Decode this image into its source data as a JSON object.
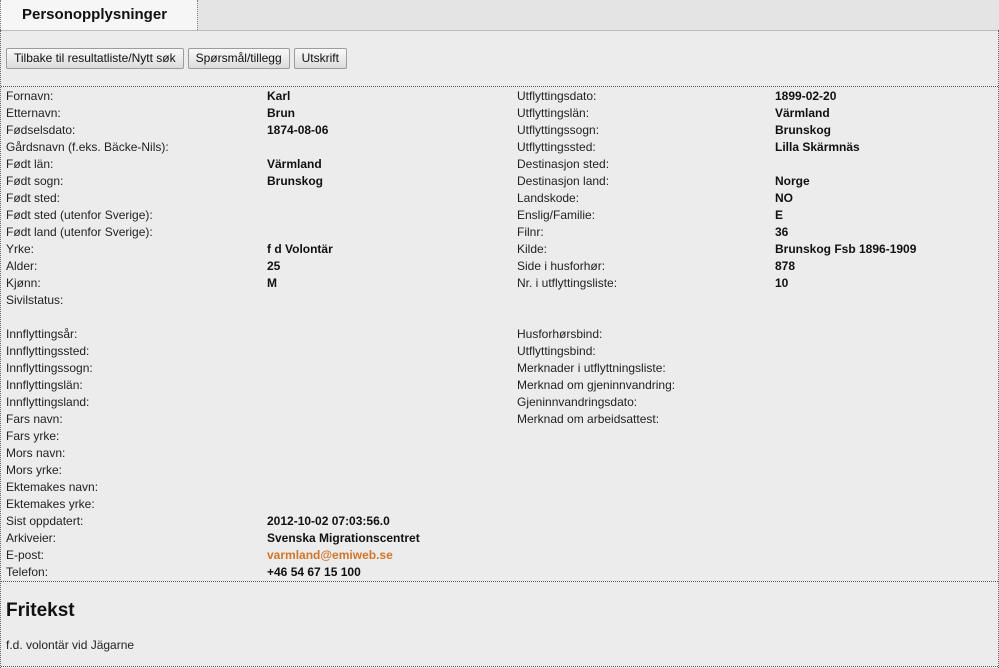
{
  "tab": {
    "title": "Personopplysninger"
  },
  "toolbar": {
    "back_label": "Tilbake til resultatliste/Nytt søk",
    "question_label": "Spørsmål/tillegg",
    "print_label": "Utskrift"
  },
  "left": {
    "group1": [
      {
        "label": "Fornavn:",
        "value": "Karl"
      },
      {
        "label": "Etternavn:",
        "value": "Brun"
      },
      {
        "label": "Fødselsdato:",
        "value": "1874-08-06"
      },
      {
        "label": "Gårdsnavn (f.eks. Bäcke-Nils):",
        "value": ""
      },
      {
        "label": "Født län:",
        "value": "Värmland"
      },
      {
        "label": "Født sogn:",
        "value": "Brunskog"
      },
      {
        "label": "Født sted:",
        "value": ""
      },
      {
        "label": "Født sted (utenfor Sverige):",
        "value": ""
      },
      {
        "label": "Født land (utenfor Sverige):",
        "value": ""
      },
      {
        "label": "Yrke:",
        "value": "f d Volontär"
      },
      {
        "label": "Alder:",
        "value": "25"
      },
      {
        "label": "Kjønn:",
        "value": "M"
      },
      {
        "label": "Sivilstatus:",
        "value": ""
      }
    ],
    "group2": [
      {
        "label": "Innflyttingsår:",
        "value": ""
      },
      {
        "label": "Innflyttingssted:",
        "value": ""
      },
      {
        "label": "Innflyttingssogn:",
        "value": ""
      },
      {
        "label": "Innflyttingslän:",
        "value": ""
      },
      {
        "label": "Innflyttingsland:",
        "value": ""
      },
      {
        "label": "Fars navn:",
        "value": ""
      },
      {
        "label": "Fars yrke:",
        "value": ""
      },
      {
        "label": "Mors navn:",
        "value": ""
      },
      {
        "label": "Mors yrke:",
        "value": ""
      },
      {
        "label": "Ektemakes navn:",
        "value": ""
      },
      {
        "label": "Ektemakes yrke:",
        "value": ""
      },
      {
        "label": "Sist oppdatert:",
        "value": "2012-10-02 07:03:56.0"
      },
      {
        "label": "Arkiveier:",
        "value": "Svenska Migrationscentret"
      },
      {
        "label": "E-post:",
        "value": "varmland@emiweb.se"
      },
      {
        "label": "Telefon:",
        "value": "+46 54 67 15 100"
      }
    ]
  },
  "right": {
    "group1": [
      {
        "label": "Utflyttingsdato:",
        "value": "1899-02-20"
      },
      {
        "label": "Utflyttingslän:",
        "value": "Värmland"
      },
      {
        "label": "Utflyttingssogn:",
        "value": "Brunskog"
      },
      {
        "label": "Utflyttingssted:",
        "value": "Lilla Skärmnäs"
      },
      {
        "label": "Destinasjon sted:",
        "value": ""
      },
      {
        "label": "Destinasjon land:",
        "value": "Norge"
      },
      {
        "label": "Landskode:",
        "value": "NO"
      },
      {
        "label": "Enslig/Familie:",
        "value": "E"
      },
      {
        "label": "Filnr:",
        "value": "36"
      },
      {
        "label": "Kilde:",
        "value": "Brunskog Fsb 1896-1909"
      },
      {
        "label": "Side i husforhør:",
        "value": "878"
      },
      {
        "label": "Nr. i utflyttingsliste:",
        "value": "10"
      }
    ],
    "group2": [
      {
        "label": "Husforhørsbind:",
        "value": ""
      },
      {
        "label": "Utflyttingsbind:",
        "value": ""
      },
      {
        "label": "Merknader i utflyttningsliste:",
        "value": ""
      },
      {
        "label": "Merknad om gjeninnvandring:",
        "value": ""
      },
      {
        "label": "Gjeninnvandringsdato:",
        "value": ""
      },
      {
        "label": "Merknad om arbeidsattest:",
        "value": ""
      }
    ]
  },
  "fritekst": {
    "title": "Fritekst",
    "text": "f.d. volontär vid Jägarne"
  },
  "colors": {
    "email_link": "#d2752a"
  }
}
